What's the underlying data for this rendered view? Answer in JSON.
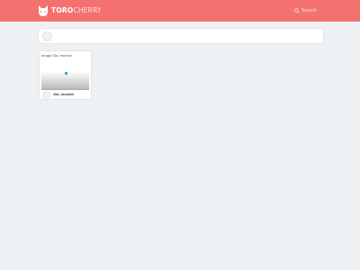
{
  "header": {
    "brand_part1": "TORO",
    "brand_part2": "CHERRY",
    "search_label": "Search"
  },
  "post": {
    "title": "Image Olá, mundo!",
    "author": "Olá, mundo!"
  },
  "colors": {
    "header_bg": "#f4716f",
    "page_bg": "#eef1f4",
    "image_dot": "#4aa0d8"
  }
}
